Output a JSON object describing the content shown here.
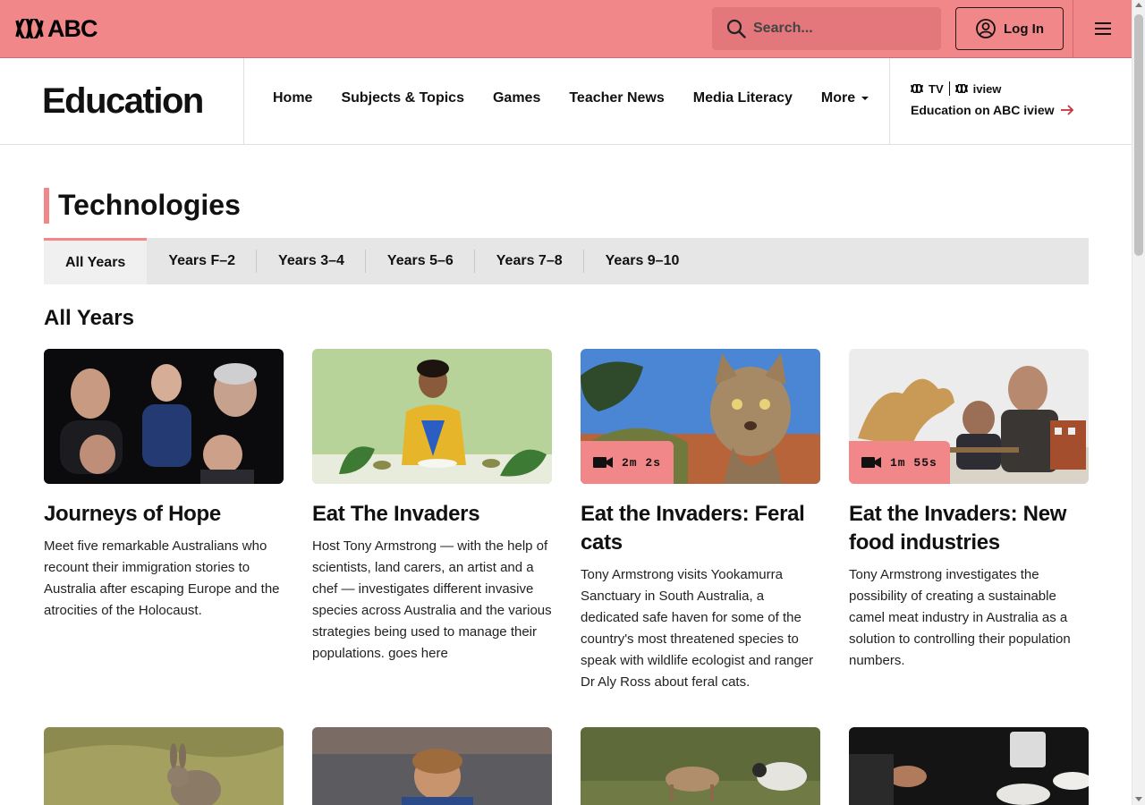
{
  "header": {
    "logo_text": "ABC",
    "search_placeholder": "Search...",
    "login_label": "Log In"
  },
  "site": {
    "title": "Education",
    "nav": [
      {
        "label": "Home"
      },
      {
        "label": "Subjects & Topics"
      },
      {
        "label": "Games"
      },
      {
        "label": "Teacher News"
      },
      {
        "label": "Media Literacy"
      },
      {
        "label": "More"
      }
    ],
    "iview": {
      "tv_label": "TV",
      "iview_label": "iview",
      "link_label": "Education on ABC iview"
    }
  },
  "page": {
    "title": "Technologies",
    "tabs": [
      {
        "label": "All Years",
        "active": true
      },
      {
        "label": "Years F–2"
      },
      {
        "label": "Years 3–4"
      },
      {
        "label": "Years 5–6"
      },
      {
        "label": "Years 7–8"
      },
      {
        "label": "Years 9–10"
      }
    ],
    "section_heading": "All Years"
  },
  "cards": [
    {
      "title": "Journeys of Hope",
      "description": "Meet five remarkable Australians who recount their immigration stories to Australia after escaping Europe and the atrocities of the Holocaust.",
      "duration": ""
    },
    {
      "title": "Eat The Invaders",
      "description": "Host Tony Armstrong — with the help of scientists, land carers, an artist and a chef — investigates different invasive species across Australia and the various strategies being used to manage their populations. goes here",
      "duration": ""
    },
    {
      "title": "Eat the Invaders: Feral cats",
      "description": "Tony Armstrong visits Yookamurra Sanctuary in South Australia, a dedicated safe haven for some of the country's most threatened species to speak with wildlife ecologist and ranger Dr Aly Ross about feral cats.",
      "duration": "2m 2s"
    },
    {
      "title": "Eat the Invaders: New food industries",
      "description": "Tony Armstrong investigates the possibility of creating a sustainable camel meat industry in Australia as a solution to controlling their population numbers.",
      "duration": "1m 55s"
    }
  ],
  "colors": {
    "accent": "#f2878a",
    "search_bg": "#e3777b"
  }
}
